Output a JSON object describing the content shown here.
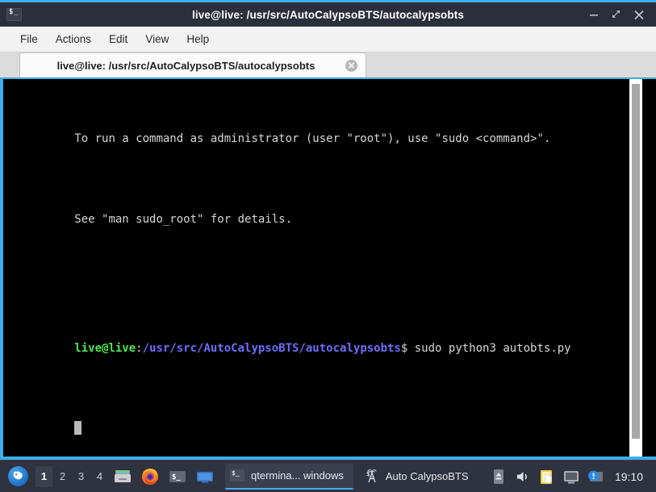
{
  "window": {
    "title": "live@live: /usr/src/AutoCalypsoBTS/autocalypsobts",
    "app_icon": "terminal-icon",
    "buttons": {
      "minimize": "minimize-button",
      "maximize": "maximize-button",
      "close": "close-button"
    }
  },
  "menubar": {
    "items": [
      {
        "label": "File"
      },
      {
        "label": "Actions"
      },
      {
        "label": "Edit"
      },
      {
        "label": "View"
      },
      {
        "label": "Help"
      }
    ]
  },
  "tabs": [
    {
      "label": "live@live: /usr/src/AutoCalypsoBTS/autocalypsobts",
      "active": true
    }
  ],
  "terminal": {
    "lines": [
      {
        "segments": [
          {
            "text": "To run a command as administrator (user \"root\"), use \"sudo <command>\".",
            "color": "plain"
          }
        ]
      },
      {
        "segments": [
          {
            "text": "See \"man sudo_root\" for details.",
            "color": "plain"
          }
        ]
      },
      {
        "segments": [
          {
            "text": "",
            "color": "plain"
          }
        ]
      },
      {
        "segments": [
          {
            "text": "live@live",
            "color": "green"
          },
          {
            "text": ":",
            "color": "plain"
          },
          {
            "text": "/usr/src/AutoCalypsoBTS/autocalypsobts",
            "color": "blue"
          },
          {
            "text": "$ sudo python3 autobts.py",
            "color": "plain"
          }
        ]
      },
      {
        "segments": [
          {
            "text": "",
            "color": "cursor"
          }
        ]
      }
    ],
    "colors": {
      "background": "#000000",
      "foreground": "#d6d6d6",
      "green": "#4ee44e",
      "blue": "#6c6cff",
      "cursor": "#b9b9b9"
    },
    "scrollbar": {
      "name": "terminal-scrollbar"
    }
  },
  "taskbar": {
    "start": {
      "name": "xfce-menu-button"
    },
    "workspaces": [
      {
        "label": "1",
        "active": true
      },
      {
        "label": "2",
        "active": false
      },
      {
        "label": "3",
        "active": false
      },
      {
        "label": "4",
        "active": false
      }
    ],
    "launchers": [
      {
        "name": "file-manager-icon"
      },
      {
        "name": "firefox-icon"
      },
      {
        "name": "terminal-icon"
      },
      {
        "name": "show-desktop-icon"
      }
    ],
    "windows": [
      {
        "label": "qtermina... windows",
        "icon": "terminal-icon",
        "active": true
      },
      {
        "label": "Auto CalypsoBTS",
        "icon": "antenna-icon",
        "active": false
      }
    ],
    "tray": [
      {
        "name": "eject-icon"
      },
      {
        "name": "volume-icon"
      },
      {
        "name": "clipboard-icon"
      },
      {
        "name": "display-icon"
      },
      {
        "name": "update-notifier-icon"
      }
    ],
    "clock": "19:10"
  },
  "colors": {
    "accent": "#3daee9",
    "titlebar_bg": "#2b2f3c",
    "menubar_bg": "#f2f2f2",
    "taskbar_bg": "#2f333f"
  }
}
